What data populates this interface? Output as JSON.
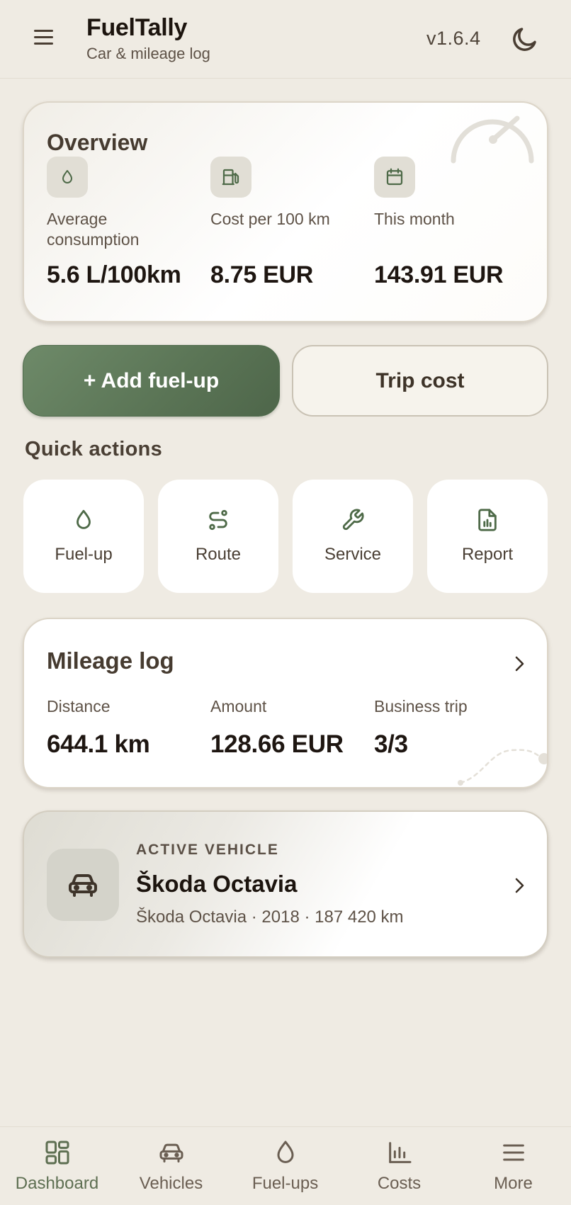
{
  "header": {
    "app_title": "FuelTally",
    "app_subtitle": "Car & mileage log",
    "version": "v1.6.4",
    "menu_icon": "hamburger-menu-icon",
    "theme_icon": "moon-icon"
  },
  "overview": {
    "title": "Overview",
    "stats": [
      {
        "icon": "droplet-icon",
        "label": "Average consumption",
        "value": "5.6 L/100km"
      },
      {
        "icon": "fuel-pump-icon",
        "label": "Cost per 100 km",
        "value": "8.75 EUR"
      },
      {
        "icon": "calendar-icon",
        "label": "This month",
        "value": "143.91 EUR"
      }
    ]
  },
  "actions": {
    "add_fuelup": "+ Add fuel-up",
    "trip_cost": "Trip cost"
  },
  "quick_actions": {
    "title": "Quick actions",
    "items": [
      {
        "icon": "droplet-icon",
        "label": "Fuel-up"
      },
      {
        "icon": "route-icon",
        "label": "Route"
      },
      {
        "icon": "wrench-icon",
        "label": "Service"
      },
      {
        "icon": "report-icon",
        "label": "Report"
      }
    ]
  },
  "mileage_log": {
    "title": "Mileage log",
    "columns": [
      {
        "label": "Distance",
        "value": "644.1 km"
      },
      {
        "label": "Amount",
        "value": "128.66 EUR"
      },
      {
        "label": "Business trip",
        "value": "3/3"
      }
    ]
  },
  "active_vehicle": {
    "kicker": "ACTIVE VEHICLE",
    "name": "Škoda Octavia",
    "detail": "Škoda Octavia · 2018 · 187 420 km",
    "icon": "car-icon"
  },
  "bottom_nav": {
    "items": [
      {
        "icon": "dashboard-icon",
        "label": "Dashboard",
        "active": true
      },
      {
        "icon": "car-icon",
        "label": "Vehicles",
        "active": false
      },
      {
        "icon": "droplet-icon",
        "label": "Fuel-ups",
        "active": false
      },
      {
        "icon": "bar-chart-icon",
        "label": "Costs",
        "active": false
      },
      {
        "icon": "menu-icon",
        "label": "More",
        "active": false
      }
    ]
  },
  "colors": {
    "background": "#efebe3",
    "primary_green": "#5e7859",
    "icon_green": "#4e6a48",
    "text_dark": "#1e1611"
  }
}
